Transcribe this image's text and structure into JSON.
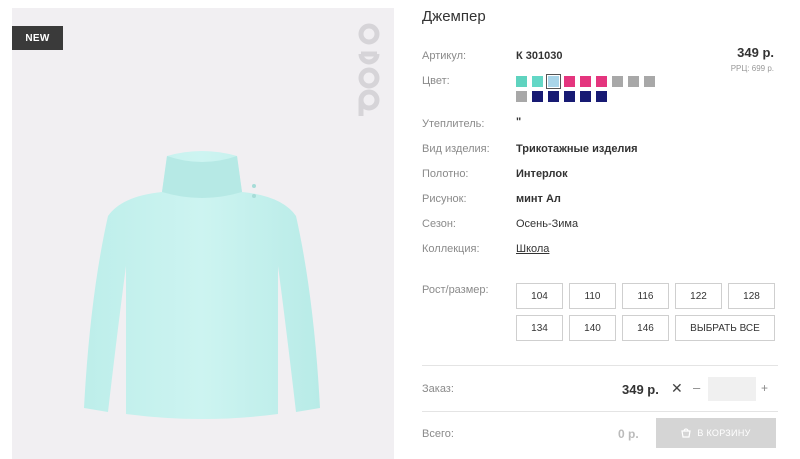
{
  "product": {
    "badge": "NEW",
    "title": "Джемпер",
    "price": "349 р.",
    "rrp": "РРЦ: 699 р."
  },
  "colors": {
    "label": "Цвет:",
    "swatches": [
      [
        "#5fd3bf",
        "#63d7c6",
        "#a9d5e9",
        "#e4357e",
        "#e4357e",
        "#e4357e",
        "#a8a8a8",
        "#a8a8a8",
        "#a8a8a8"
      ],
      [
        "#a8a8a8",
        "#171a73",
        "#171a73",
        "#171a73",
        "#171a73",
        "#171a73"
      ]
    ],
    "selected_index": 2
  },
  "attributes": [
    {
      "label": "Артикул:",
      "value": "К 301030"
    },
    {
      "label": "Утеплитель:",
      "value": "\""
    },
    {
      "label": "Вид изделия:",
      "value": "Трикотажные изделия"
    },
    {
      "label": "Полотно:",
      "value": "Интерлок"
    },
    {
      "label": "Рисунок:",
      "value": "минт Ал"
    },
    {
      "label": "Сезон:",
      "value": "Осень-Зима"
    },
    {
      "label": "Коллекция:",
      "value": "Школа"
    }
  ],
  "sizes": {
    "label": "Рост/размер:",
    "options": [
      "104",
      "110",
      "116",
      "122",
      "128",
      "134",
      "140",
      "146"
    ],
    "select_all": "ВЫБРАТЬ ВСЕ"
  },
  "order": {
    "label": "Заказ:",
    "price": "349 р.",
    "remove": "✕",
    "minus": "–",
    "plus": "+",
    "quantity": ""
  },
  "total": {
    "label": "Всего:",
    "value": "0 р.",
    "cart_button": "В КОРЗИНУ"
  },
  "theme": {
    "photo_bg": "#f1eff2",
    "garment": "#c8f1ee",
    "button_disabled": "#d5d5d5"
  }
}
